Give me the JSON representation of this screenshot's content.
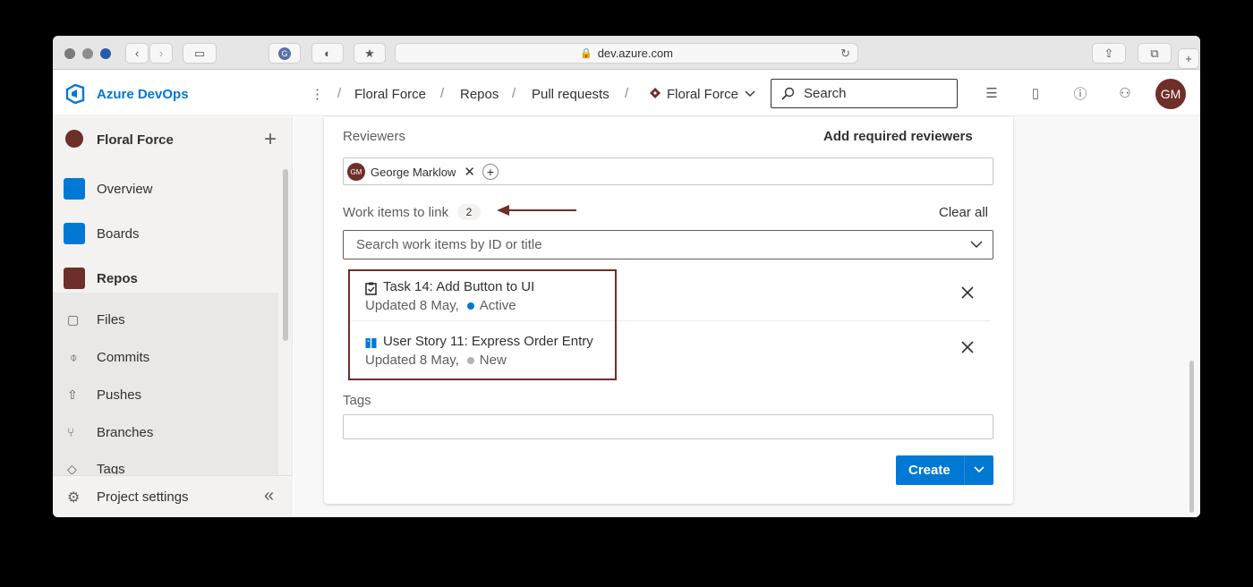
{
  "browser": {
    "url": "dev.azure.com",
    "icons": [
      "back-icon",
      "forward-icon",
      "sidebar-icon",
      "grammarly-icon",
      "shield-icon",
      "star-icon",
      "reload-icon",
      "share-icon",
      "tabs-icon",
      "new-tab-icon"
    ]
  },
  "header": {
    "brand": "Azure DevOps",
    "breadcrumb": [
      "Floral Force",
      "Repos",
      "Pull requests"
    ],
    "repo_selector": "Floral Force",
    "search_placeholder": "Search",
    "user_initials": "GM"
  },
  "sidebar": {
    "project": "Floral Force",
    "items": [
      {
        "label": "Overview",
        "icon": "overview-icon",
        "color": "#0078d4"
      },
      {
        "label": "Boards",
        "icon": "boards-icon",
        "color": "#0078d4"
      },
      {
        "label": "Repos",
        "icon": "repos-icon",
        "color": "#6e2e2a"
      }
    ],
    "repo_items": [
      {
        "label": "Files",
        "icon": "files-icon"
      },
      {
        "label": "Commits",
        "icon": "commits-icon"
      },
      {
        "label": "Pushes",
        "icon": "pushes-icon"
      },
      {
        "label": "Branches",
        "icon": "branches-icon"
      },
      {
        "label": "Tags",
        "icon": "tags-icon"
      }
    ],
    "settings": "Project settings"
  },
  "form": {
    "reviewers_label": "Reviewers",
    "add_required": "Add required reviewers",
    "reviewer": {
      "initials": "GM",
      "name": "George Marklow"
    },
    "work_items_label": "Work items to link",
    "work_items_count": "2",
    "clear_all": "Clear all",
    "work_items_placeholder": "Search work items by ID or title",
    "work_items": [
      {
        "title": "Task 14: Add Button to UI",
        "updated": "Updated 8 May,",
        "state": "Active",
        "state_color": "#0078d4",
        "icon": "task-icon"
      },
      {
        "title": "User Story 11: Express Order Entry",
        "updated": "Updated 8 May,",
        "state": "New",
        "state_color": "#b2b2b2",
        "icon": "user-story-icon"
      }
    ],
    "tags_label": "Tags",
    "create_label": "Create"
  },
  "colors": {
    "accent": "#0078d4",
    "project": "#6e2e2a",
    "annotation": "#6e2e2a"
  }
}
